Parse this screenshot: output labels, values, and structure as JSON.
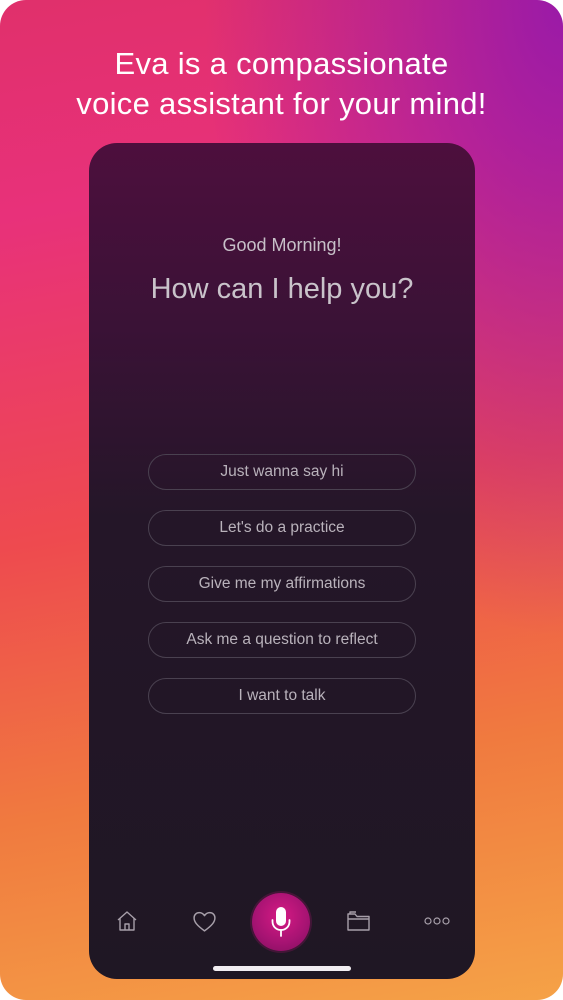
{
  "headline": {
    "line1": "Eva is a compassionate",
    "line2": "voice assistant for your mind!"
  },
  "screen": {
    "greeting": "Good Morning!",
    "question": "How can I help you?",
    "options": [
      "Just wanna say hi",
      "Let's do a practice",
      "Give me my affirmations",
      "Ask me a question to reflect",
      "I want to talk"
    ]
  },
  "tabbar": {
    "icons": [
      "home-icon",
      "heart-icon",
      "microphone-icon",
      "folder-icon",
      "more-icon"
    ],
    "mic_color": "#c0157a"
  },
  "colors": {
    "gradient_top": "#e0306b",
    "gradient_bottom": "#f5a247",
    "screen_bg": "#1f1724"
  }
}
